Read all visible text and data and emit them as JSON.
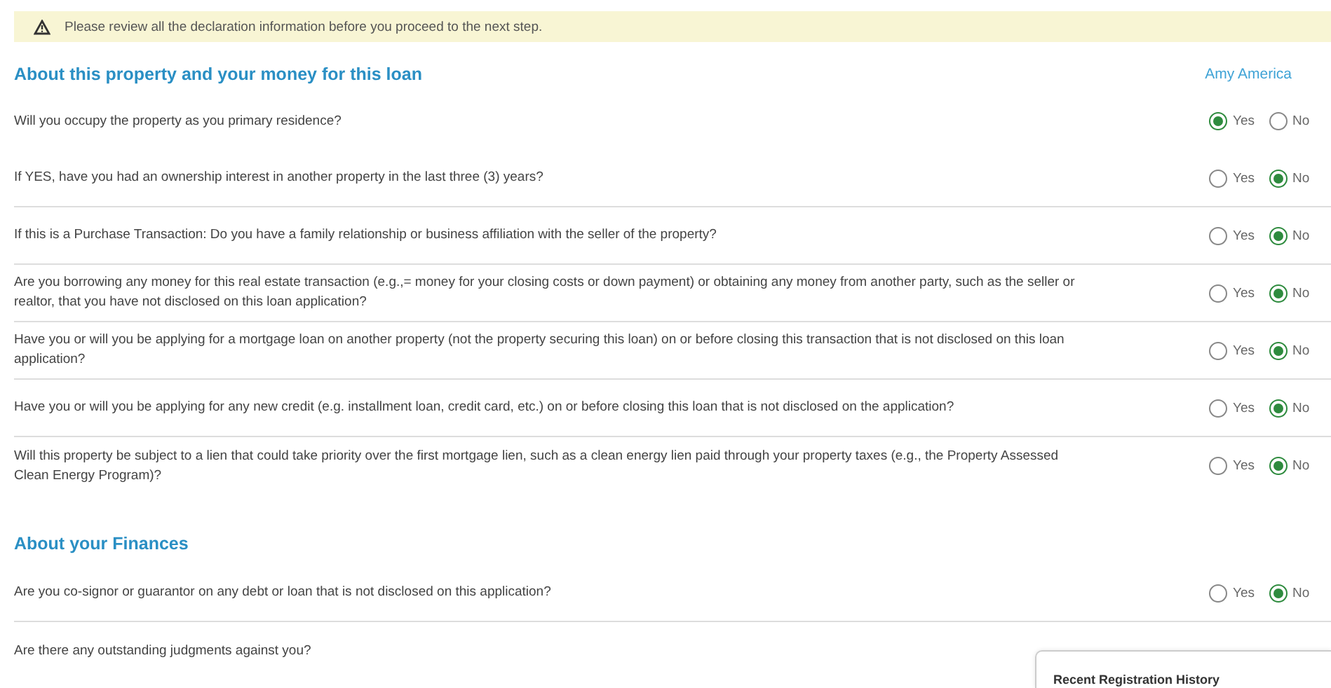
{
  "banner": {
    "text": "Please review all the declaration information before you proceed to the next step."
  },
  "sections": [
    {
      "title": "About this property and your money for this loan",
      "borrower": "Amy America",
      "questions": [
        {
          "text": "Will you occupy the property as you primary residence?",
          "options": [
            {
              "label": "Yes",
              "selected": true
            },
            {
              "label": "No",
              "selected": false
            }
          ]
        },
        {
          "text": "If YES, have you had an ownership interest in another property in the last three (3) years?",
          "options": [
            {
              "label": "Yes",
              "selected": false
            },
            {
              "label": "No",
              "selected": true
            }
          ]
        },
        {
          "text": "If this is a Purchase Transaction: Do you have a family relationship or business affiliation with the seller of the property?",
          "options": [
            {
              "label": "Yes",
              "selected": false
            },
            {
              "label": "No",
              "selected": true
            }
          ]
        },
        {
          "text": "Are you borrowing any money for this real estate transaction (e.g.,= money for your closing costs or down payment) or obtaining any money from another party, such as the seller or realtor, that you have not disclosed on this loan application?",
          "options": [
            {
              "label": "Yes",
              "selected": false
            },
            {
              "label": "No",
              "selected": true
            }
          ]
        },
        {
          "text": "Have you or will you be applying for a mortgage loan on another property (not the property securing this loan) on or before closing this transaction that is not disclosed on this loan application?",
          "options": [
            {
              "label": "Yes",
              "selected": false
            },
            {
              "label": "No",
              "selected": true
            }
          ]
        },
        {
          "text": "Have you or will you be applying for any new credit (e.g. installment loan, credit card, etc.) on or before closing this loan that is not disclosed on the application?",
          "options": [
            {
              "label": "Yes",
              "selected": false
            },
            {
              "label": "No",
              "selected": true
            }
          ]
        },
        {
          "text": "Will this property be subject to a lien that could take priority over the first mortgage lien, such as a clean energy lien paid through your property taxes (e.g., the Property Assessed Clean Energy Program)?",
          "options": [
            {
              "label": "Yes",
              "selected": false
            },
            {
              "label": "No",
              "selected": true
            }
          ]
        }
      ]
    },
    {
      "title": "About your Finances",
      "questions": [
        {
          "text": "Are you co-signor or guarantor on any debt or loan that is not disclosed on this application?",
          "options": [
            {
              "label": "Yes",
              "selected": false
            },
            {
              "label": "No",
              "selected": true
            }
          ]
        },
        {
          "text": "Are there any outstanding judgments against you?"
        }
      ]
    }
  ],
  "history_panel": {
    "title": "Recent Registration History"
  }
}
